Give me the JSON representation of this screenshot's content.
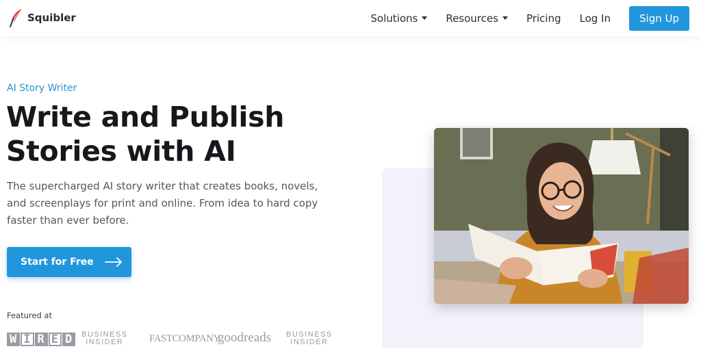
{
  "brand": {
    "name": "Squibler"
  },
  "nav": {
    "items": [
      {
        "label": "Solutions",
        "dropdown": true
      },
      {
        "label": "Resources",
        "dropdown": true
      },
      {
        "label": "Pricing",
        "dropdown": false
      },
      {
        "label": "Log In",
        "dropdown": false
      }
    ],
    "signup_label": "Sign Up"
  },
  "hero": {
    "eyebrow": "AI Story Writer",
    "headline_line1": "Write and Publish",
    "headline_line2": "Stories with AI",
    "subcopy": "The supercharged AI story writer that creates books, novels, and screenplays for print and online. From idea to hard copy faster than ever before.",
    "cta_label": "Start for Free"
  },
  "featured": {
    "label": "Featured at",
    "logos": {
      "wired": [
        "W",
        "I",
        "R",
        "E",
        "D"
      ],
      "business_insider_top": "BUSINESS",
      "business_insider_bottom": "INSIDER",
      "fast_company": "FASTCOMPANY",
      "goodreads": "goodreads"
    }
  },
  "colors": {
    "accent": "#2196dc",
    "eyebrow": "#2a93d5",
    "heading": "#17171c",
    "body": "#55555f"
  },
  "icons": {
    "brand": "quill-feather-icon",
    "cta": "arrow-right-icon",
    "dropdown": "caret-down-icon"
  }
}
